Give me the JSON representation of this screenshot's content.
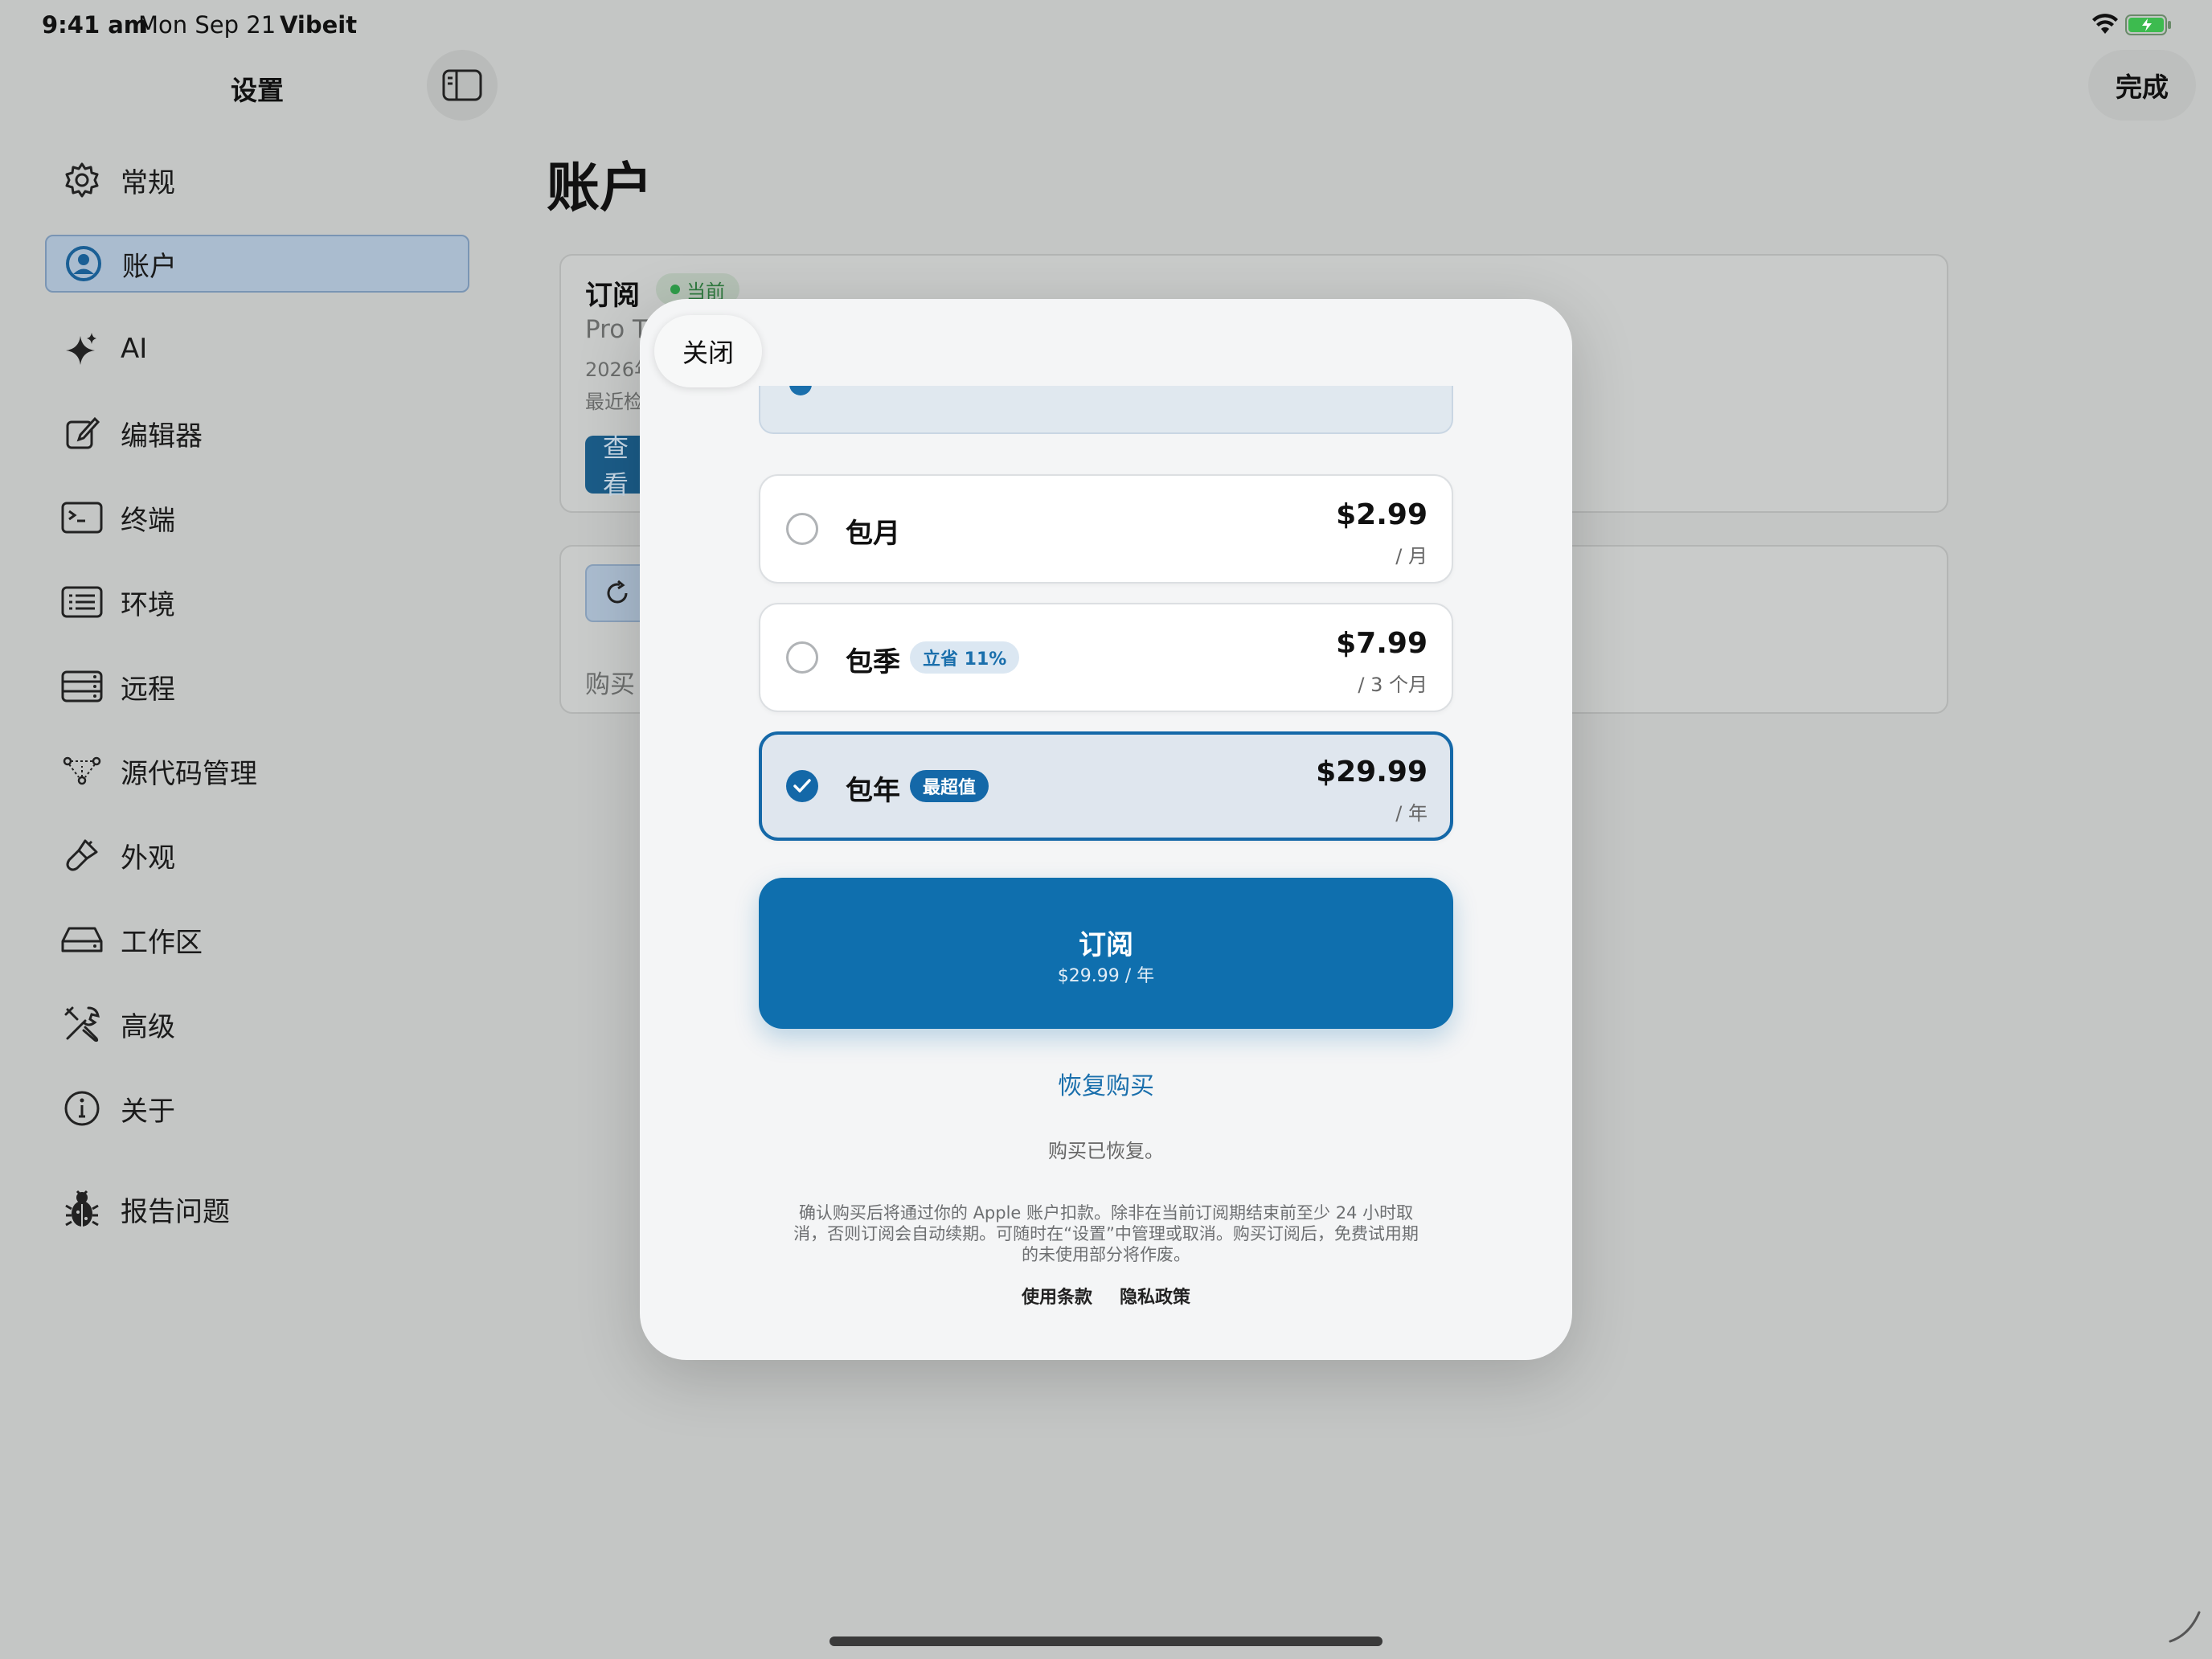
{
  "status_bar": {
    "time": "9:41 am",
    "date": "Mon Sep 21",
    "app": "Vibeit"
  },
  "sidebar": {
    "title": "设置",
    "items": [
      {
        "label": "常规",
        "icon": "gear-icon"
      },
      {
        "label": "账户",
        "icon": "account-icon",
        "active": true
      },
      {
        "label": "AI",
        "icon": "sparkle-icon"
      },
      {
        "label": "编辑器",
        "icon": "edit-icon"
      },
      {
        "label": "终端",
        "icon": "terminal-icon"
      },
      {
        "label": "环境",
        "icon": "list-icon"
      },
      {
        "label": "远程",
        "icon": "server-icon"
      },
      {
        "label": "源代码管理",
        "icon": "branch-icon"
      },
      {
        "label": "外观",
        "icon": "brush-icon"
      },
      {
        "label": "工作区",
        "icon": "drive-icon"
      },
      {
        "label": "高级",
        "icon": "tools-icon"
      },
      {
        "label": "关于",
        "icon": "info-icon"
      },
      {
        "label": "报告问题",
        "icon": "bug-icon"
      }
    ]
  },
  "header": {
    "done_label": "完成"
  },
  "main": {
    "title": "账户",
    "subscription_card": {
      "title": "订阅",
      "badge": "当前",
      "line1": "Pro T",
      "line2": "2026年",
      "line3": "最近检",
      "button": "查看"
    },
    "restore_card": {
      "text": "购买"
    }
  },
  "modal": {
    "close_label": "关闭",
    "plans": [
      {
        "name": "包月",
        "tag": "",
        "price": "$2.99",
        "period": "/ 月",
        "selected": false
      },
      {
        "name": "包季",
        "tag": "立省 11%",
        "price": "$7.99",
        "period": "/ 3 个月",
        "selected": false
      },
      {
        "name": "包年",
        "tag": "最超值",
        "price": "$29.99",
        "period": "/ 年",
        "selected": true
      }
    ],
    "subscribe_label": "订阅",
    "subscribe_sub": "$29.99 / 年",
    "restore_link": "恢复购买",
    "restored_message": "购买已恢复。",
    "legal_text": "确认购买后将通过你的 Apple 账户扣款。除非在当前订阅期结束前至少 24 小时取消，否则订阅会自动续期。可随时在“设置”中管理或取消。购买订阅后，免费试用期的未使用部分将作废。",
    "terms_label": "使用条款",
    "privacy_label": "隐私政策"
  },
  "colors": {
    "accent": "#1468a8",
    "success": "#2f9d4a"
  }
}
